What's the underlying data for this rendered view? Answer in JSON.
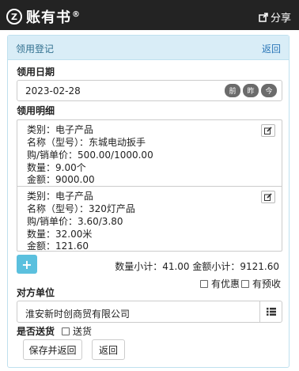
{
  "header": {
    "logo_mark": "Z",
    "logo_text": "账有书",
    "logo_reg": "®",
    "share_label": "分享"
  },
  "panel": {
    "title": "领用登记",
    "back_label": "返回"
  },
  "date_section": {
    "label": "领用日期",
    "value": "2023-02-28",
    "buttons": [
      "前",
      "昨",
      "今"
    ]
  },
  "detail_section": {
    "label": "领用明细",
    "items": [
      {
        "category": "类别：电子产品",
        "name": "名称（型号）：东城电动扳手",
        "price": "购/销单价：500.00/1000.00",
        "quantity": "数量：9.00个",
        "amount": "金额：9000.00"
      },
      {
        "category": "类别：电子产品",
        "name": "名称（型号）：320灯产品",
        "price": "购/销单价：3.60/3.80",
        "quantity": "数量：32.00米",
        "amount": "金额：121.60"
      }
    ],
    "add_label": "+",
    "summary": "数量小计：41.00  金额小计：9121.60"
  },
  "options": {
    "discount": "有优惠",
    "prepaid": "有预收"
  },
  "counterparty": {
    "label": "对方单位",
    "value": "淮安新时创商贸有限公司"
  },
  "delivery": {
    "label": "是否送货",
    "option": "送货"
  },
  "actions": {
    "save_return": "保存并返回",
    "back": "返回"
  },
  "colors": {
    "topbar": "#232323",
    "panel_header_bg": "#d9edf7",
    "panel_title": "#31708f",
    "link": "#2a76b8",
    "add_button": "#5bc0de",
    "date_pill": "#6b6b6b"
  }
}
